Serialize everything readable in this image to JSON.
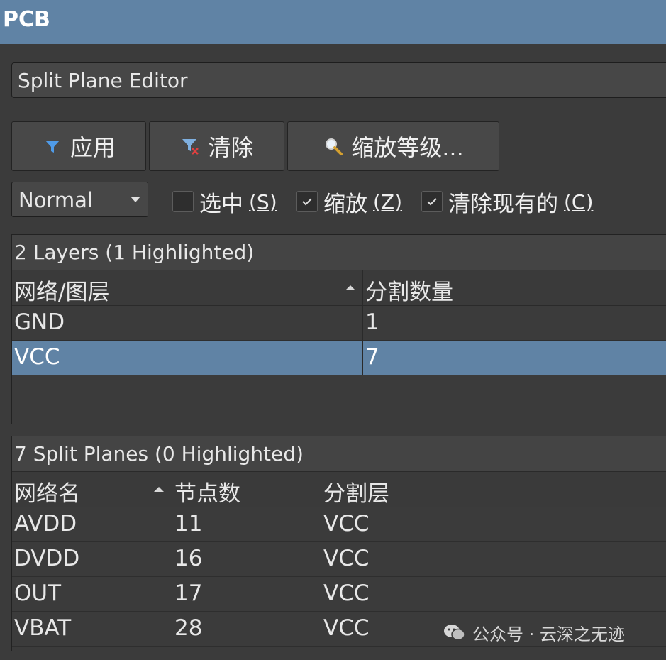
{
  "window": {
    "title": "PCB"
  },
  "editor": {
    "selected": "Split Plane Editor"
  },
  "toolbar": {
    "apply_label": "应用",
    "clear_label": "清除",
    "zoom_label": "缩放等级..."
  },
  "filter": {
    "mode": "Normal",
    "select_label": "选中",
    "select_key": "(S)",
    "select_checked": false,
    "zoom_label": "缩放",
    "zoom_key": "(Z)",
    "zoom_checked": true,
    "clear_label": "清除现有的",
    "clear_key": "(C)",
    "clear_checked": true
  },
  "layers_panel": {
    "title": "2 Layers (1 Highlighted)",
    "columns": [
      "网络/图层",
      "分割数量"
    ],
    "rows": [
      {
        "net": "GND",
        "count": "1"
      },
      {
        "net": "VCC",
        "count": "7"
      }
    ]
  },
  "planes_panel": {
    "title": "7 Split Planes (0 Highlighted)",
    "columns": [
      "网络名",
      "节点数",
      "分割层"
    ],
    "rows": [
      {
        "net": "AVDD",
        "nodes": "11",
        "layer": "VCC"
      },
      {
        "net": "DVDD",
        "nodes": "16",
        "layer": "VCC"
      },
      {
        "net": "OUT",
        "nodes": "17",
        "layer": "VCC"
      },
      {
        "net": "VBAT",
        "nodes": "28",
        "layer": "VCC"
      }
    ]
  },
  "watermark": {
    "text": "公众号 · 云深之无迹"
  },
  "colors": {
    "titlebar": "#6083a5",
    "selected_row": "#6083a5",
    "background": "#3b3b3b"
  }
}
